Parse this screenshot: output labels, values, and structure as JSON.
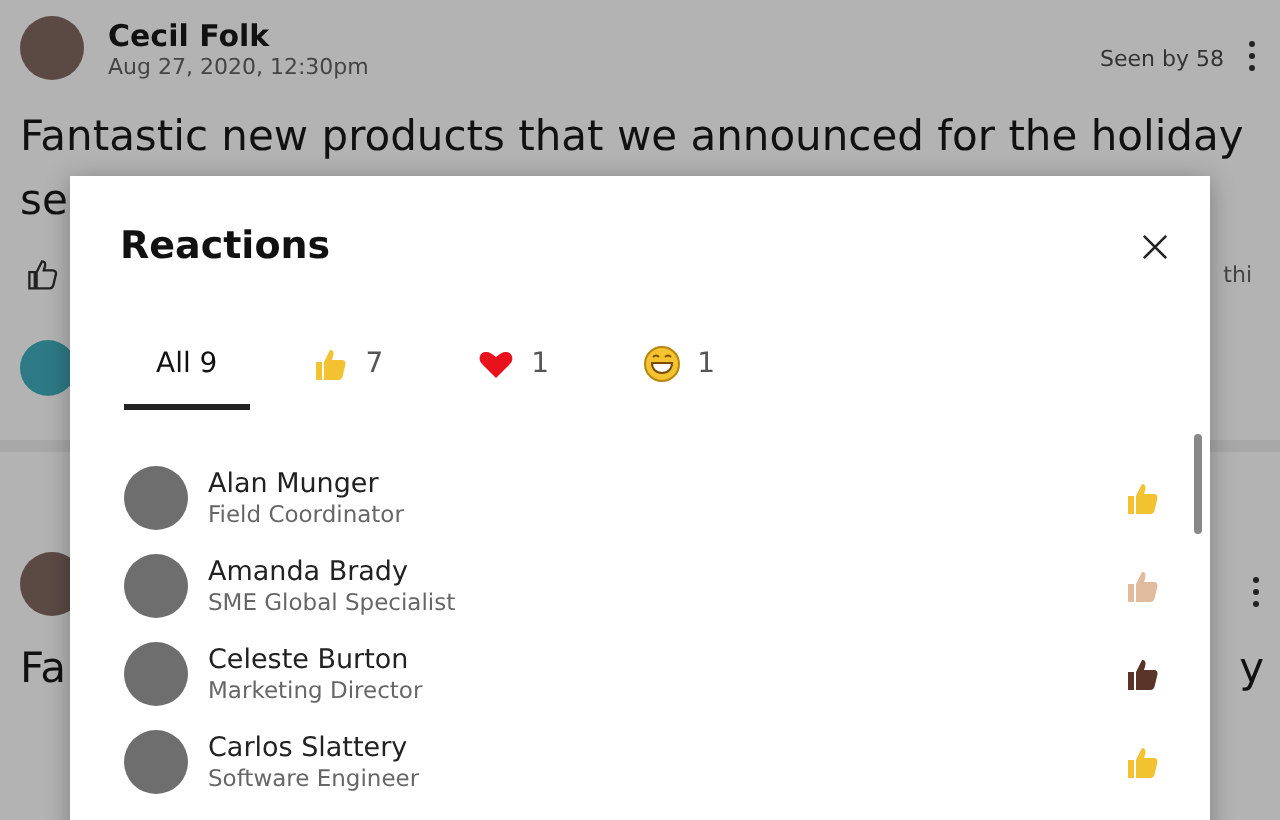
{
  "post": {
    "author": "Cecil Folk",
    "time": "Aug 27, 2020, 12:30pm",
    "seen": "Seen by 58",
    "text_line_1": "Fantastic new products that we announced for the holiday",
    "text_line_2": "se",
    "side_text": "thi"
  },
  "next_post": {
    "text_start": "Fa",
    "text_end": "y"
  },
  "dialog": {
    "title": "Reactions",
    "tabs": [
      {
        "kind": "all",
        "label": "All 9",
        "selected": true
      },
      {
        "kind": "like",
        "label": "7",
        "selected": false
      },
      {
        "kind": "heart",
        "label": "1",
        "selected": false
      },
      {
        "kind": "laugh",
        "label": "1",
        "selected": false
      }
    ],
    "people": [
      {
        "name": "Alan Munger",
        "role": "Field Coordinator",
        "kind": "like",
        "color": "#f2c231"
      },
      {
        "name": "Amanda Brady",
        "role": "SME Global Specialist",
        "kind": "like",
        "color": "#e0bc9c"
      },
      {
        "name": "Celeste Burton",
        "role": "Marketing Director",
        "kind": "like",
        "color": "#5a3427"
      },
      {
        "name": "Carlos Slattery",
        "role": "Software Engineer",
        "kind": "like",
        "color": "#f2c231"
      }
    ]
  }
}
